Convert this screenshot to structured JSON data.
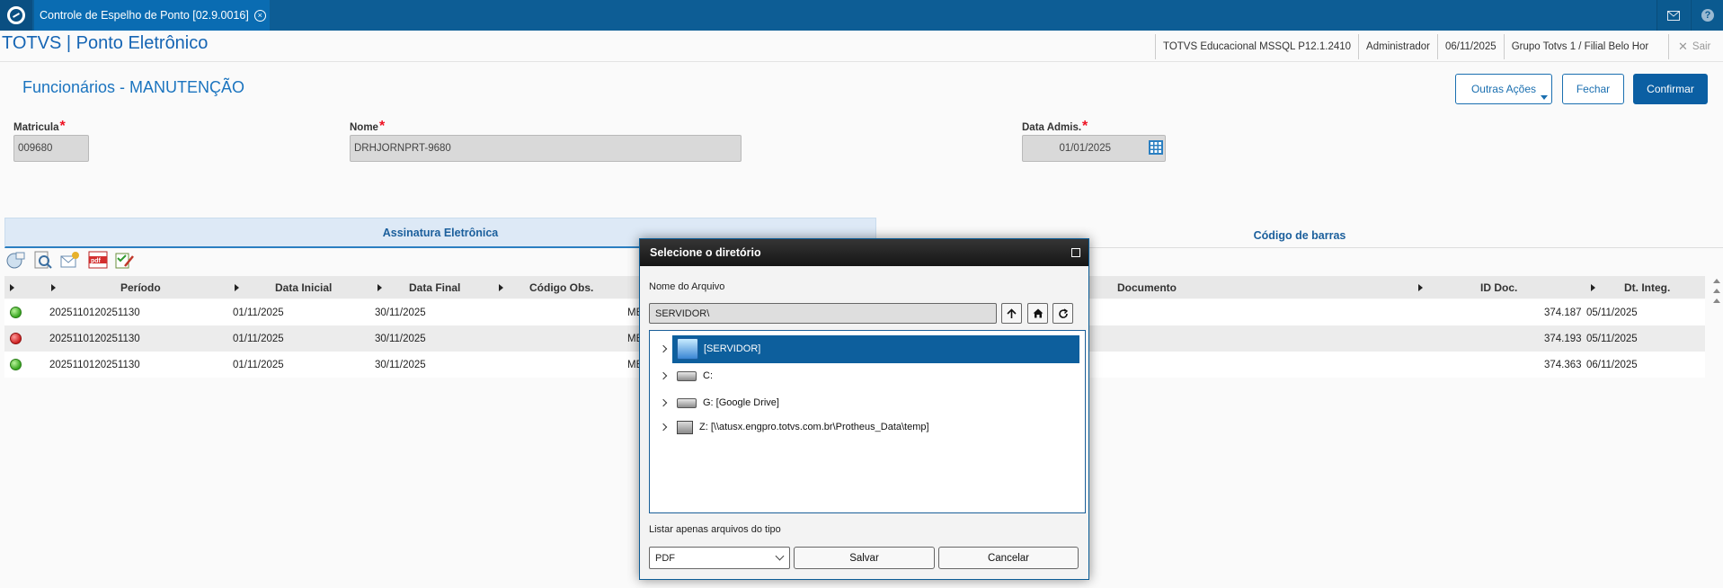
{
  "window": {
    "tab_title": "Controle de Espelho de Ponto [02.9.0016]"
  },
  "header": {
    "app_title": "TOTVS | Ponto Eletrônico",
    "environment": "TOTVS Educacional MSSQL P12.1.2410",
    "user": "Administrador",
    "date": "06/11/2025",
    "company": "Grupo Totvs 1 / Filial Belo Hor",
    "exit_label": "Sair"
  },
  "page": {
    "title": "Funcionários - MANUTENÇÃO",
    "actions": {
      "outras": "Outras Ações",
      "fechar": "Fechar",
      "confirmar": "Confirmar"
    }
  },
  "form": {
    "matricula": {
      "label": "Matricula",
      "value": "009680"
    },
    "nome": {
      "label": "Nome",
      "value": "DRHJORNPRT-9680"
    },
    "data_admis": {
      "label": "Data Admis.",
      "value": "01/01/2025"
    }
  },
  "tabs": [
    "Assinatura Eletrônica",
    "Código de barras"
  ],
  "toolbar_icons": [
    "legend-icon",
    "search-doc-icon",
    "email-icon",
    "pdf-icon",
    "sign-icon"
  ],
  "grid": {
    "columns": [
      "Período",
      "Data Inicial",
      "Data Final",
      "Código Obs.",
      "Documento",
      "ID Doc.",
      "Dt. Integ."
    ],
    "rows": [
      {
        "status": "green",
        "periodo": "2025110120251130",
        "data_ini": "01/11/2025",
        "data_fim": "30/11/2025",
        "cod_obs": "ME",
        "id_doc": "374.187",
        "dt_integ": "05/11/2025"
      },
      {
        "status": "red",
        "periodo": "2025110120251130",
        "data_ini": "01/11/2025",
        "data_fim": "30/11/2025",
        "cod_obs": "ME",
        "id_doc": "374.193",
        "dt_integ": "05/11/2025"
      },
      {
        "status": "green",
        "periodo": "2025110120251130",
        "data_ini": "01/11/2025",
        "data_fim": "30/11/2025",
        "cod_obs": "ME",
        "id_doc": "374.363",
        "dt_integ": "06/11/2025"
      }
    ]
  },
  "dialog": {
    "title": "Selecione o diretório",
    "filename_label": "Nome do Arquivo",
    "path_value": "SERVIDOR\\",
    "tree": [
      "[SERVIDOR]",
      "C:",
      "G: [Google Drive]",
      "Z: [\\\\atusx.engpro.totvs.com.br\\Protheus_Data\\temp]"
    ],
    "filter_label": "Listar apenas arquivos do tipo",
    "filter_value": "PDF",
    "save": "Salvar",
    "cancel": "Cancelar"
  },
  "colors": {
    "topbar": "#0d5d95",
    "accent": "#1b74bf",
    "dialog_title": "#1e1e1e",
    "selection": "#0d5f9d"
  }
}
